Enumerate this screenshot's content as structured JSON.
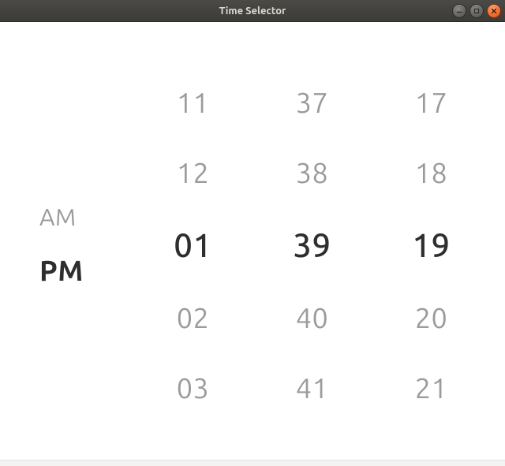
{
  "window": {
    "title": "Time Selector"
  },
  "ampm": {
    "options": [
      "AM",
      "PM"
    ],
    "selected": "PM"
  },
  "hours": {
    "visible": [
      "11",
      "12",
      "01",
      "02",
      "03"
    ],
    "selected": "01"
  },
  "minutes": {
    "visible": [
      "37",
      "38",
      "39",
      "40",
      "41"
    ],
    "selected": "39"
  },
  "seconds": {
    "visible": [
      "17",
      "18",
      "19",
      "20",
      "21"
    ],
    "selected": "19"
  }
}
